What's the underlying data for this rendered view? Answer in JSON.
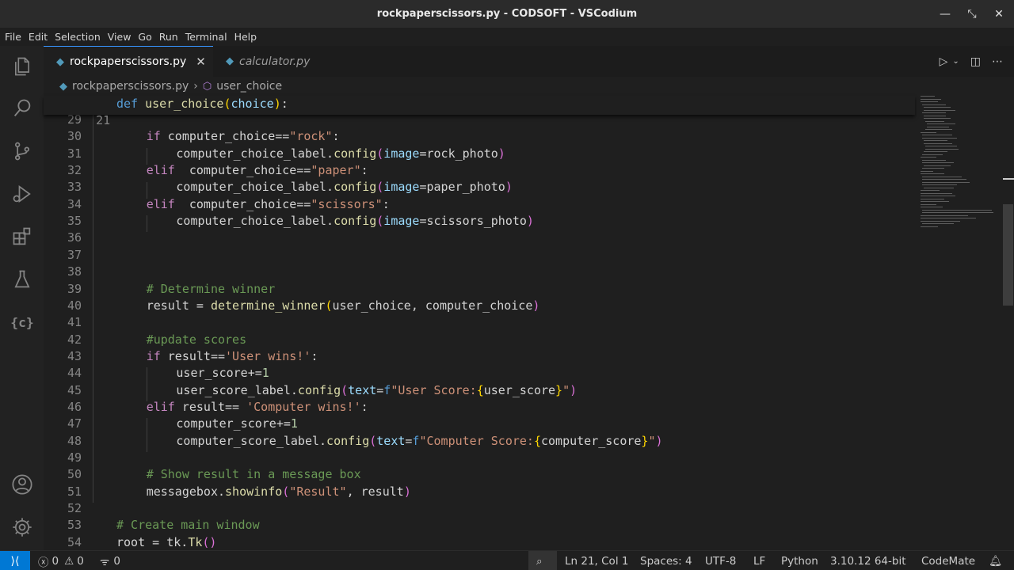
{
  "window": {
    "title": "rockpaperscissors.py - CODSOFT - VSCodium",
    "minimize_icon": "minimize-icon",
    "restore_icon": "restore-icon",
    "close_icon": "close-icon"
  },
  "menu": [
    "File",
    "Edit",
    "Selection",
    "View",
    "Go",
    "Run",
    "Terminal",
    "Help"
  ],
  "tabs": [
    {
      "label": "rockpaperscissors.py",
      "active": true
    },
    {
      "label": "calculator.py",
      "active": false
    }
  ],
  "breadcrumb": {
    "file": "rockpaperscissors.py",
    "symbol": "user_choice"
  },
  "sticky": {
    "line_no": "21",
    "code": "def user_choice(choice):"
  },
  "line_numbers": [
    "29",
    "30",
    "31",
    "32",
    "33",
    "34",
    "35",
    "36",
    "37",
    "38",
    "39",
    "40",
    "41",
    "42",
    "43",
    "44",
    "45",
    "46",
    "47",
    "48",
    "49",
    "50",
    "51",
    "52",
    "53",
    "54"
  ],
  "code_lines": [
    "",
    "if computer_choice==\"rock\":",
    "computer_choice_label.config(image=rock_photo)",
    "elif  computer_choice==\"paper\":",
    "computer_choice_label.config(image=paper_photo)",
    "elif  computer_choice==\"scissors\":",
    "computer_choice_label.config(image=scissors_photo)",
    "",
    "",
    "",
    "# Determine winner",
    "result = determine_winner(user_choice, computer_choice)",
    "",
    "#update scores",
    "if result=='User wins!':",
    "user_score+=1",
    "user_score_label.config(text=f\"User Score:{user_score}\")",
    "elif result== 'Computer wins!':",
    "computer_score+=1",
    "computer_score_label.config(text=f\"Computer Score:{computer_score}\")",
    "",
    "# Show result in a message box",
    "messagebox.showinfo(\"Result\", result)",
    "",
    "# Create main window",
    "root = tk.Tk()"
  ],
  "status": {
    "errors": "0",
    "warnings": "0",
    "ports": "0",
    "cursor": "Ln 21, Col 1",
    "spaces": "Spaces: 4",
    "encoding": "UTF-8",
    "eol": "LF",
    "language": "Python",
    "interpreter": "3.10.12 64-bit",
    "extension": "CodeMate"
  },
  "colors": {
    "accent": "#0078d4",
    "keyword": "#569cd6",
    "control": "#c586c0",
    "string": "#ce9178",
    "comment": "#6a9955",
    "function": "#dcdcaa"
  },
  "activity_icons": [
    "explorer-icon",
    "search-icon",
    "source-control-icon",
    "run-debug-icon",
    "extensions-icon",
    "testing-icon",
    "variables-icon",
    "account-icon",
    "settings-gear-icon"
  ]
}
